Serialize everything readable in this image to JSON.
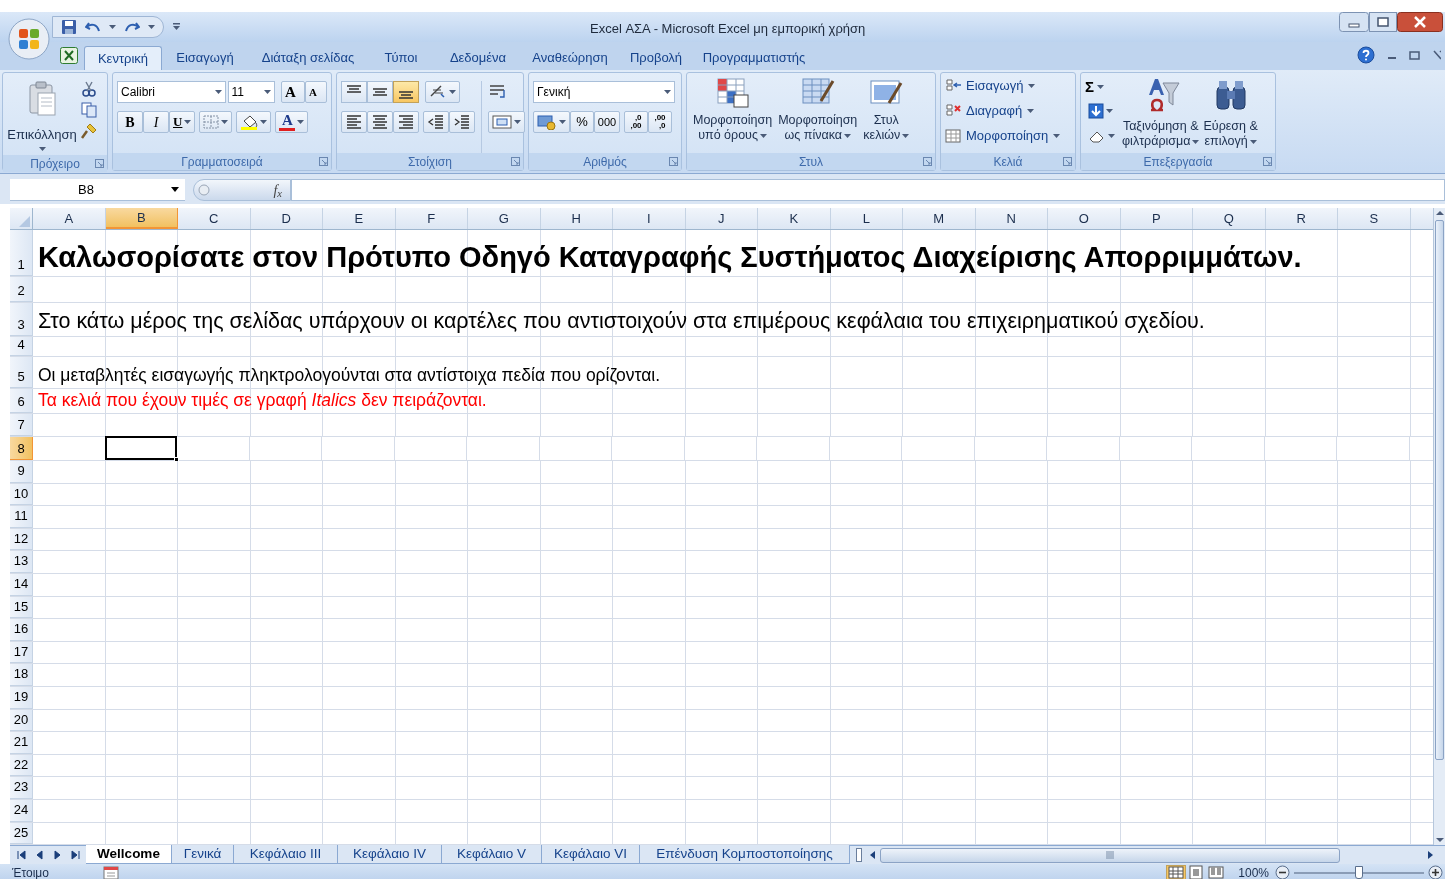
{
  "window": {
    "title": "Excel ΑΣΑ - Microsoft Excel μη εμπορική χρήση"
  },
  "ribbon_tabs": [
    {
      "label": "Κεντρική",
      "selected": true
    },
    {
      "label": "Εισαγωγή",
      "selected": false
    },
    {
      "label": "Διάταξη σελίδας",
      "selected": false
    },
    {
      "label": "Τύποι",
      "selected": false
    },
    {
      "label": "Δεδομένα",
      "selected": false
    },
    {
      "label": "Αναθεώρηση",
      "selected": false
    },
    {
      "label": "Προβολή",
      "selected": false
    },
    {
      "label": "Προγραμματιστής",
      "selected": false
    }
  ],
  "clipboard": {
    "group": "Πρόχειρο",
    "paste": "Επικόλληση"
  },
  "font": {
    "group": "Γραμματοσειρά",
    "name": "Calibri",
    "size": "11",
    "grow": "A",
    "shrink": "A",
    "bold": "B",
    "italic": "I",
    "underline": "U",
    "font_color": "A"
  },
  "alignment": {
    "group": "Στοίχιση",
    "vertical": [
      {
        "kind": "top",
        "selected": false
      },
      {
        "kind": "middle",
        "selected": false
      },
      {
        "kind": "bottom",
        "selected": true
      }
    ]
  },
  "number": {
    "group": "Αριθμός",
    "format": "Γενική",
    "percent": "%",
    "thousands": "000",
    "decimals": [
      {
        "top": ",0",
        "bottom": ",00"
      },
      {
        "top": ",00",
        "bottom": ",0"
      }
    ]
  },
  "styles": {
    "group": "Στυλ",
    "buttons": [
      {
        "kind": "conditional",
        "lines": [
          "Μορφοποίηση",
          "υπό όρους"
        ]
      },
      {
        "kind": "table",
        "lines": [
          "Μορφοποίηση",
          "ως πίνακα"
        ]
      },
      {
        "kind": "cell",
        "lines": [
          "Στυλ",
          "κελιών"
        ]
      }
    ]
  },
  "cells": {
    "group": "Κελιά",
    "items": [
      {
        "kind": "insert",
        "label": "Εισαγωγή"
      },
      {
        "kind": "delete",
        "label": "Διαγραφή"
      },
      {
        "kind": "format",
        "label": "Μορφοποίηση"
      }
    ]
  },
  "editing": {
    "group": "Επεξεργασία",
    "sum": "Σ",
    "sort": [
      "Ταξινόμηση &",
      "φιλτράρισμα"
    ],
    "find": [
      "Εύρεση &",
      "επιλογή"
    ]
  },
  "name_box": "B8",
  "formula_label": "f$_{x}$",
  "columns": [
    {
      "label": "A",
      "selected": false
    },
    {
      "label": "B",
      "selected": true
    },
    {
      "label": "C",
      "selected": false
    },
    {
      "label": "D",
      "selected": false
    },
    {
      "label": "E",
      "selected": false
    },
    {
      "label": "F",
      "selected": false
    },
    {
      "label": "G",
      "selected": false
    },
    {
      "label": "H",
      "selected": false
    },
    {
      "label": "I",
      "selected": false
    },
    {
      "label": "J",
      "selected": false
    },
    {
      "label": "K",
      "selected": false
    },
    {
      "label": "L",
      "selected": false
    },
    {
      "label": "M",
      "selected": false
    },
    {
      "label": "N",
      "selected": false
    },
    {
      "label": "O",
      "selected": false
    },
    {
      "label": "P",
      "selected": false
    },
    {
      "label": "Q",
      "selected": false
    },
    {
      "label": "R",
      "selected": false
    },
    {
      "label": "S",
      "selected": false
    }
  ],
  "rows": [
    {
      "number": "1",
      "selected": false,
      "kind": "heading",
      "text": "Καλωσορίσατε στον Πρότυπο Οδηγό Καταγραφής Συστήματος Διαχείρισης Απορριμμάτων."
    },
    {
      "number": "2",
      "selected": false
    },
    {
      "number": "3",
      "selected": false,
      "kind": "large",
      "text": "Στο κάτω μέρος της σελίδας υπάρχουν οι καρτέλες που αντιστοιχούν στα επιμέρους κεφάλαια του επιχειρηματικού σχεδίου."
    },
    {
      "number": "4",
      "selected": false
    },
    {
      "number": "5",
      "selected": false,
      "kind": "body",
      "text": "Οι μεταβλητές εισαγωγής πληκτρολογούνται στα αντίστοιχα πεδία που ορίζονται."
    },
    {
      "number": "6",
      "selected": false,
      "kind": "note",
      "text": "Τα κελιά που έχουν τιμές σε γραφή *Italics* δεν πειράζονται."
    },
    {
      "number": "7",
      "selected": false
    },
    {
      "number": "8",
      "selected": true
    },
    {
      "number": "9",
      "selected": false
    },
    {
      "number": "10",
      "selected": false
    },
    {
      "number": "11",
      "selected": false
    },
    {
      "number": "12",
      "selected": false
    },
    {
      "number": "13",
      "selected": false
    },
    {
      "number": "14",
      "selected": false
    },
    {
      "number": "15",
      "selected": false
    },
    {
      "number": "16",
      "selected": false
    },
    {
      "number": "17",
      "selected": false
    },
    {
      "number": "18",
      "selected": false
    },
    {
      "number": "19",
      "selected": false
    },
    {
      "number": "20",
      "selected": false
    },
    {
      "number": "21",
      "selected": false
    },
    {
      "number": "22",
      "selected": false
    },
    {
      "number": "23",
      "selected": false
    },
    {
      "number": "24",
      "selected": false
    },
    {
      "number": "25",
      "selected": false
    }
  ],
  "sheets": [
    {
      "label": "Wellcome",
      "selected": true
    },
    {
      "label": "Γενικά",
      "selected": false
    },
    {
      "label": "Κεφάλαιο ΙΙΙ",
      "selected": false
    },
    {
      "label": "Κεφάλαιο ΙV",
      "selected": false
    },
    {
      "label": "Κεφάλαιο V",
      "selected": false
    },
    {
      "label": "Κεφάλαιο VI",
      "selected": false
    },
    {
      "label": "Επένδυση Κομποστοποίησης",
      "selected": false
    }
  ],
  "status_bar": {
    "text": "Έτοιμο",
    "views": [
      {
        "kind": "normal",
        "selected": true
      },
      {
        "kind": "layout",
        "selected": false
      },
      {
        "kind": "break",
        "selected": false
      }
    ],
    "zoom": "100%",
    "zoom_slider": {
      "level": 0.5
    }
  }
}
